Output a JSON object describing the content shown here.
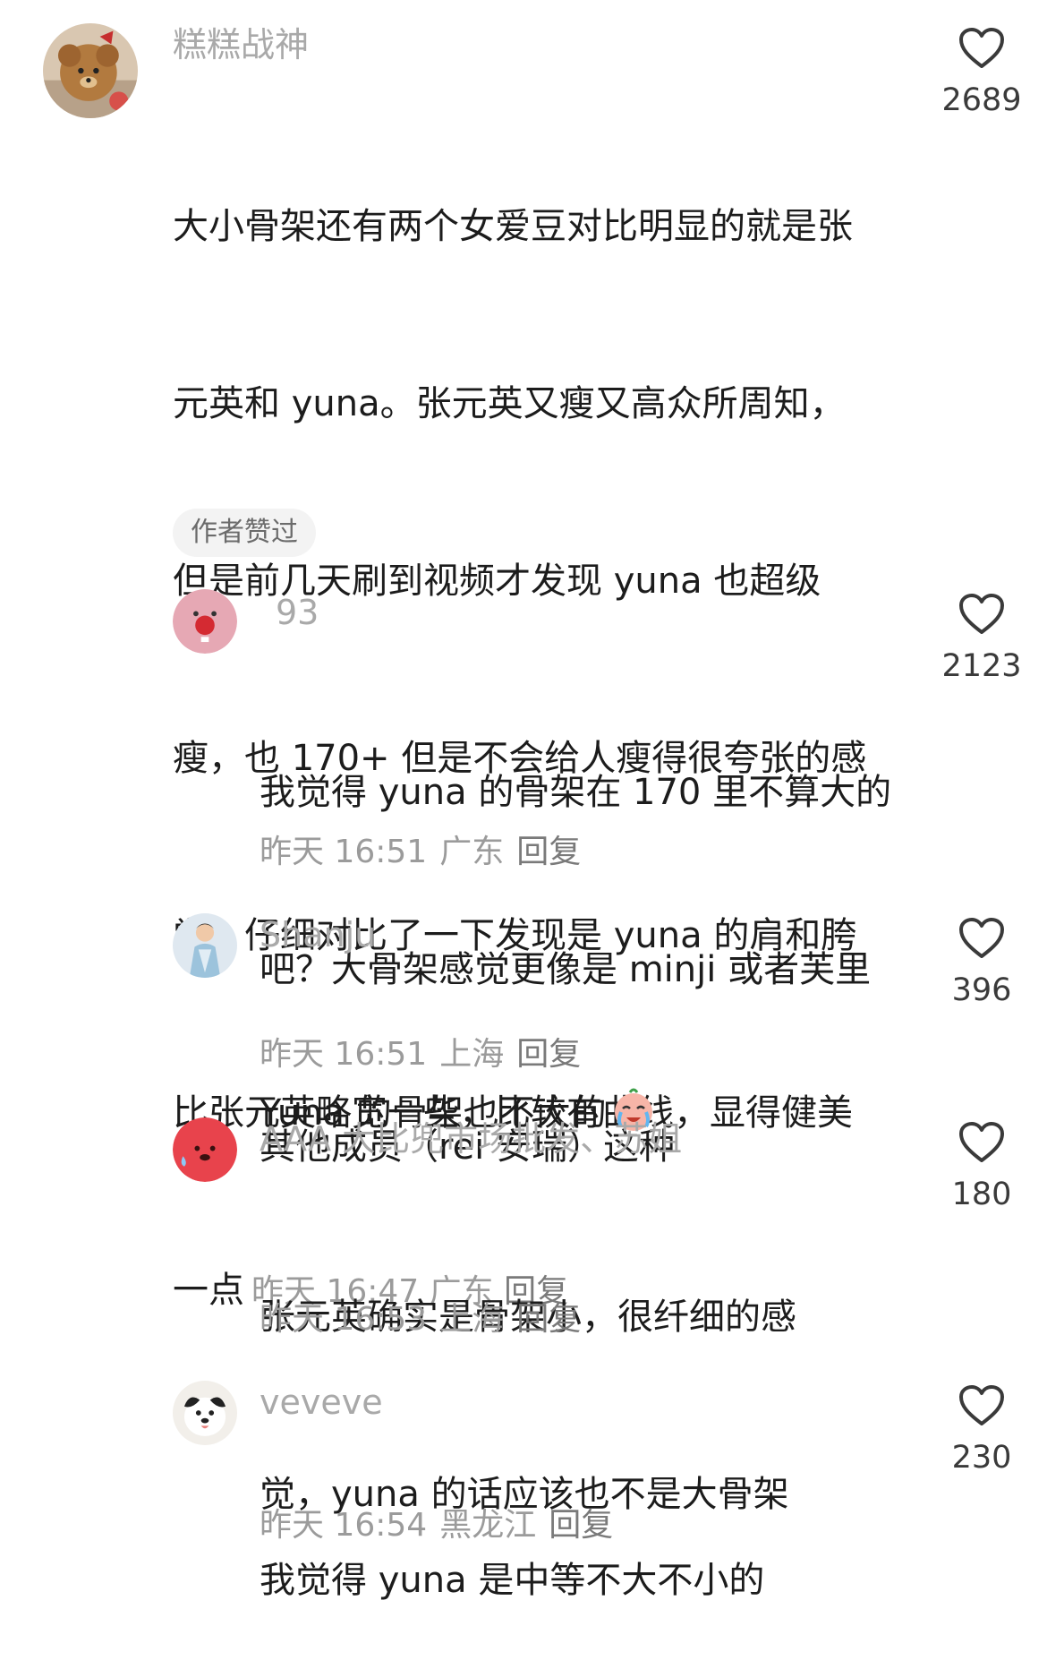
{
  "comments": [
    {
      "author": "糕糕战神",
      "avatar": "teddy-bear-avatar",
      "text_lines": [
        "大小骨架还有两个女爱豆对比明显的就是张",
        "元英和 yuna。张元英又瘦又高众所周知，",
        "但是前几天刷到视频才发现 yuna 也超级",
        "瘦，也 170+ 但是不会给人瘦得很夸张的感",
        "觉。仔细对比了一下发现是 yuna 的肩和胯",
        "比张元英略宽一些，比较有曲线，显得健美",
        "一点"
      ],
      "time": "昨天 16:47",
      "location": "广东",
      "reply_label": "回复",
      "likes": "2689",
      "badge": "作者赞过"
    },
    {
      "author": "93",
      "avatar": "pink-clown-avatar",
      "text_lines": [
        "我觉得 yuna 的骨架在 170 里不算大的",
        "吧？大骨架感觉更像是 minji 或者芙里",
        "其他成员（rei 安瑞）这种"
      ],
      "time": "昨天 16:51",
      "location": "广东",
      "reply_label": "回复",
      "likes": "2123"
    },
    {
      "author": "Shanju",
      "avatar": "skater-avatar",
      "text_lines": [
        "Yuna 的骨架也不大的"
      ],
      "emoji": "crying-face-emoji",
      "time": "昨天 16:51",
      "location": "上海",
      "reply_label": "回复",
      "likes": "396"
    },
    {
      "author": "AAA 大比兜市场批发、苏姐",
      "avatar": "red-blob-avatar",
      "text_lines": [
        "张元英确实是骨架小，很纤细的感",
        "觉，yuna 的话应该也不是大骨架"
      ],
      "time": "昨天 16:53",
      "location": "上海",
      "reply_label": "回复",
      "likes": "180"
    },
    {
      "author": "veveve",
      "avatar": "puppy-avatar",
      "text_lines": [
        "我觉得 yuna 是中等不大不小的"
      ],
      "time": "昨天 16:54",
      "location": "黑龙江",
      "reply_label": "回复",
      "likes": "230"
    }
  ],
  "colors": {
    "author": "#a9a9a9",
    "text": "#1c1c1c",
    "meta": "#9b9b9b",
    "heart": "#3a3a3a",
    "badge_bg": "#f3f3f3"
  }
}
